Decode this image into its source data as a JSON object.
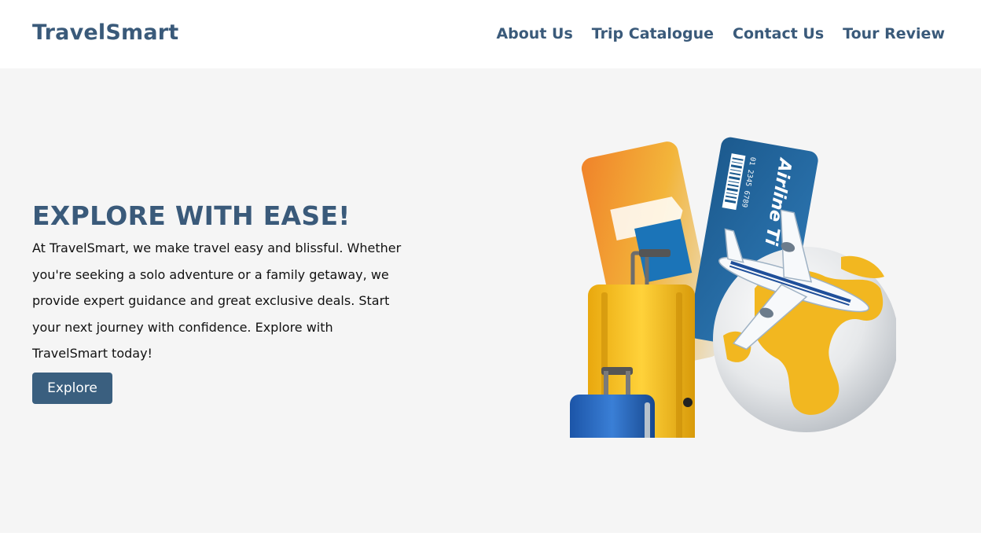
{
  "nav": {
    "logo": "TravelSmart",
    "links": [
      "About Us",
      "Trip Catalogue",
      "Contact Us",
      "Tour Review"
    ]
  },
  "hero": {
    "title": "EXPLORE WITH EASE!",
    "description": "At TravelSmart, we make travel easy and blissful. Whether you're seeking a solo adventure or a family getaway, we provide expert guidance and great exclusive deals. Start your next journey with confidence. Explore with TravelSmart today!",
    "button_label": "Explore",
    "illustration": {
      "ticket_text": "Airline Ti",
      "ticket_number": "01 2345 6789"
    }
  },
  "colors": {
    "brand": "#3a5a7a",
    "button": "#3a5f7f",
    "hero_bg": "#f5f5f5"
  }
}
